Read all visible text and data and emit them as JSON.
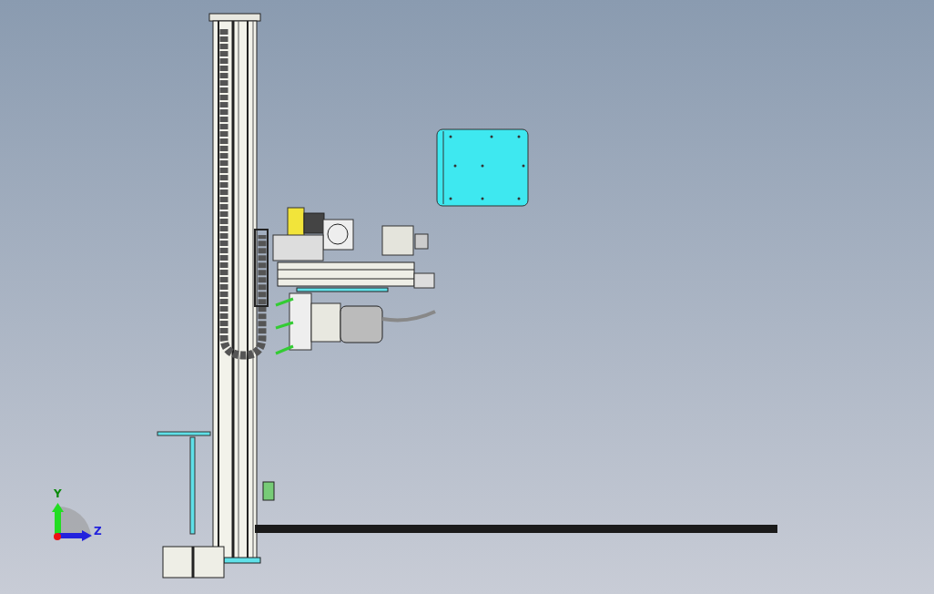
{
  "viewport": {
    "triad": {
      "axes": [
        {
          "label": "Y",
          "kind": "vertical"
        },
        {
          "label": "Z",
          "kind": "horizontal"
        }
      ]
    }
  }
}
